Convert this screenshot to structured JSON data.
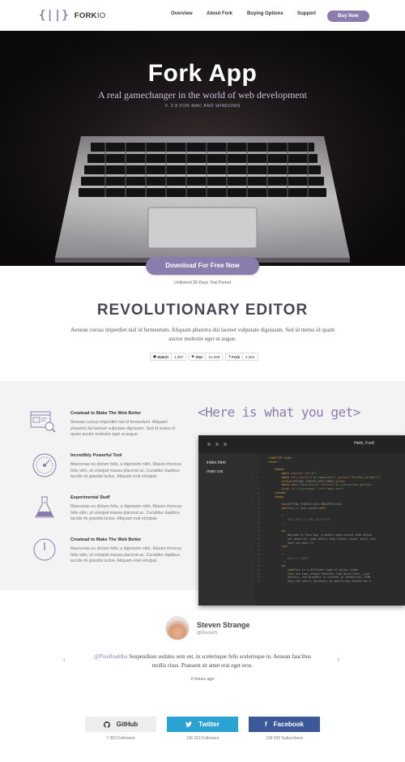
{
  "header": {
    "logo_mark": "{||}",
    "logo_name_bold": "FORK",
    "logo_name_light": "IO",
    "nav": [
      "Overview",
      "About Fork",
      "Buying Options",
      "Support"
    ],
    "buy_label": "Buy Now"
  },
  "hero": {
    "title": "Fork App",
    "subtitle": "A real gamechanger in the world of web development",
    "version": "V. 2.8 FOR MAC AND WINDOWS",
    "download_label": "Download For Free Now",
    "trial_note": "Unlimited 30-Days Trial Period"
  },
  "editor_section": {
    "heading": "REVOLUTIONARY EDITOR",
    "text": "Aenean cursus imperdiet nisl id fermentum. Aliquam pharetra dui laoreet vulputate dignissim. Sed id metus id quam auctor molestie eget ut augue.",
    "github_buttons": [
      {
        "label": "Watch",
        "count": "1,397"
      },
      {
        "label": "Star",
        "count": "21,038"
      },
      {
        "label": "Fork",
        "count": "4,301"
      }
    ]
  },
  "features": [
    {
      "icon": "browser-search-icon",
      "title": "Createad to Make The Web Better",
      "text": "Aenean cursus imperdiet nisl id fermentum. Aliquam pharetra dui laoreet vulputate dignissim. Sed id metus id quam auctor molestie eget ut augue."
    },
    {
      "icon": "gauge-icon",
      "title": "Incredibly Powerful Tool",
      "text": "Maecenas eu dictum felis, a dignissim nibh. Mauris rhoncus felis odio, ut volutpat massa placerat ac. Curabitur dapibus iaculis mi gravida luctus. Aliquam erat volutpat."
    },
    {
      "icon": "flask-icon",
      "title": "Experimental Stuff",
      "text": "Maecenas eu dictum felis, a dignissim nibh. Mauris rhoncus felis odio, ut volutpat massa placerat ac. Curabitur dapibus iaculis mi gravida luctus. Aliquam erat volutpat."
    },
    {
      "icon": "power-icon",
      "title": "Createad to Make The Web Better",
      "text": "Maecenas eu dictum felis, a dignissim nibh. Mauris rhoncus felis odio, ut volutpat massa placerat ac. Curabitur dapibus iaculis mi gravida luctus. Aliquam erat volutpat."
    }
  ],
  "code_panel": {
    "heading": "<Here is what you get>",
    "window_title": "Hello, Fork!",
    "files": [
      "index.html",
      "main.css"
    ]
  },
  "testimonial": {
    "name": "Steven Strange",
    "handle": "@DoctorS",
    "mention": "@Pixelbuddha",
    "quote": " Suspendisse sodales sem est, in scelerisque felis scelerisque in. Aenean faucibus mollis risus. Praesent sit amet erat eget eros.",
    "time": "2 hours ago"
  },
  "social": [
    {
      "label": "GitHub",
      "followers": "7 352 Followers",
      "bg": "#eeeeee",
      "fg": "#333333"
    },
    {
      "label": "Twitter",
      "followers": "136 312 Followers",
      "bg": "#2aa3d2",
      "fg": "#ffffff"
    },
    {
      "label": "Facebook",
      "followers": "218 092 Subscribers",
      "bg": "#3b5998",
      "fg": "#ffffff"
    }
  ],
  "colors": {
    "accent": "#8a7cac"
  }
}
